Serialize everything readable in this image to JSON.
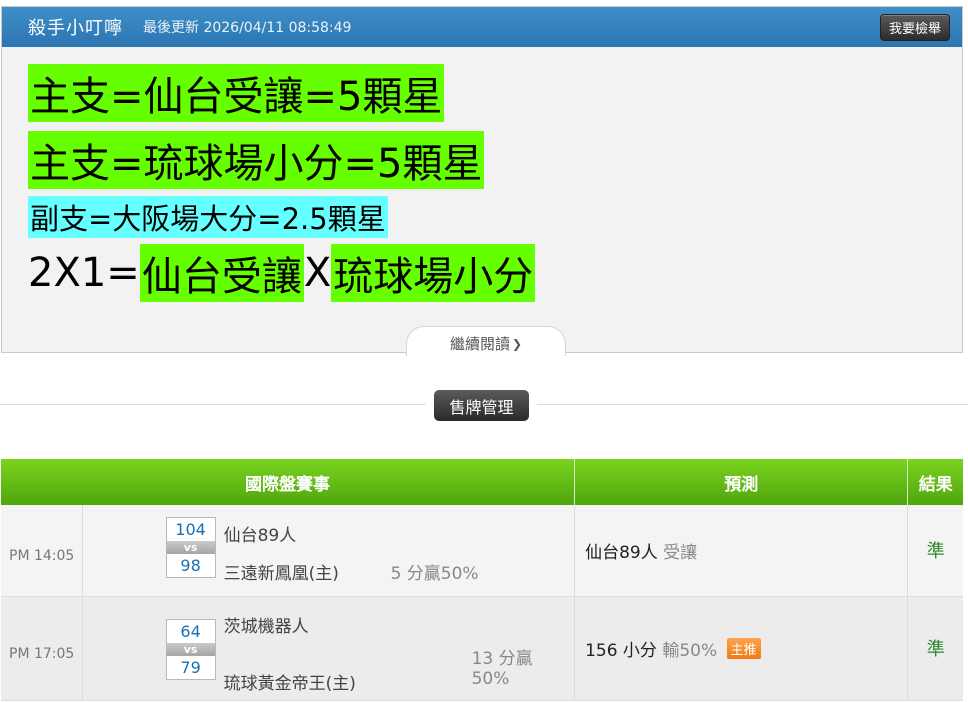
{
  "notice": {
    "title": "殺手小叮嚀",
    "updated": "最後更新 2026/04/11 08:58:49",
    "check_button": "我要檢舉",
    "line1": "主支=仙台受讓=5顆星",
    "line2": "主支=琉球場小分=5顆星",
    "line3": "副支=大阪場大分=2.5顆星",
    "line4": {
      "prefix": "2X1=",
      "part1": "仙台受讓",
      "sep": "X",
      "part2": "琉球場小分"
    },
    "highlight_colors": {
      "green": "#66ff00",
      "cyan": "#66ffff"
    },
    "read_more": "繼續閱讀"
  },
  "manage_button": "售牌管理",
  "table": {
    "headers": {
      "event": "國際盤賽事",
      "prediction": "預測",
      "result": "結果"
    },
    "rows": [
      {
        "time": "PM 14:05",
        "score_home": "104",
        "vs": "vs",
        "score_away": "98",
        "team1": "仙台89人",
        "team2": "三遠新鳳凰(主)",
        "handicap_a": "5 分贏50%",
        "prediction_main": "仙台89人",
        "prediction_sub": "受讓",
        "result": "準"
      },
      {
        "time": "PM 17:05",
        "score_home": "64",
        "vs": "vs",
        "score_away": "79",
        "team1": "茨城機器人",
        "team2": "琉球黃金帝王(主)",
        "handicap_a": "13 分贏",
        "handicap_b": "50%",
        "prediction_main": "156 小分",
        "prediction_sub": "輸50%",
        "badge": "主推",
        "result": "準"
      }
    ]
  }
}
